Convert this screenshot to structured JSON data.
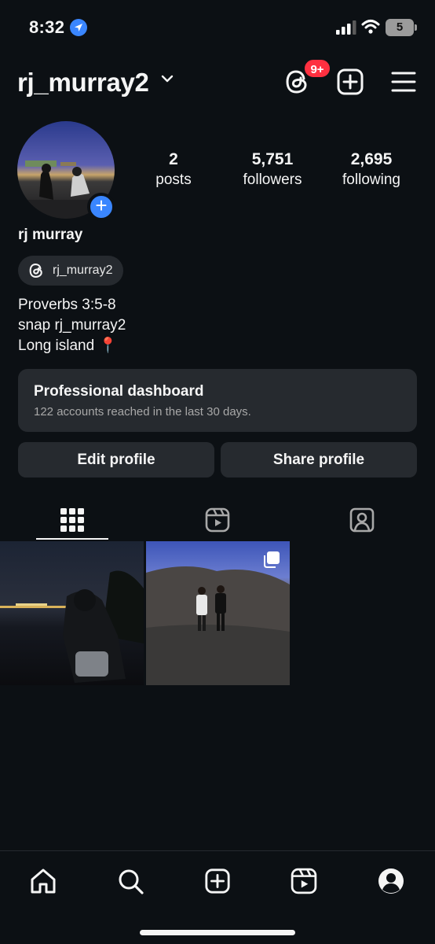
{
  "status_bar": {
    "time": "8:32",
    "battery": "5"
  },
  "header": {
    "username": "rj_murray2",
    "notification_badge": "9+"
  },
  "profile": {
    "display_name": "rj murray",
    "threads_handle": "rj_murray2",
    "stats": {
      "posts_value": "2",
      "posts_label": "posts",
      "followers_value": "5,751",
      "followers_label": "followers",
      "following_value": "2,695",
      "following_label": "following"
    },
    "bio": {
      "line1": "Proverbs 3:5-8",
      "line2": "snap rj_murray2",
      "line3": "Long island 📍"
    }
  },
  "dashboard": {
    "title": "Professional dashboard",
    "subtitle": "122 accounts reached in the last 30 days."
  },
  "actions": {
    "edit_label": "Edit profile",
    "share_label": "Share profile"
  },
  "tabs": [
    "grid-icon",
    "reels-icon",
    "tagged-icon"
  ],
  "bottom_nav": [
    "home-icon",
    "search-icon",
    "create-icon",
    "reels-icon",
    "profile-icon"
  ],
  "colors": {
    "background": "#0c1014",
    "surface": "#262a2f",
    "accent_blue": "#3a86ff",
    "badge_red": "#ff3040"
  }
}
